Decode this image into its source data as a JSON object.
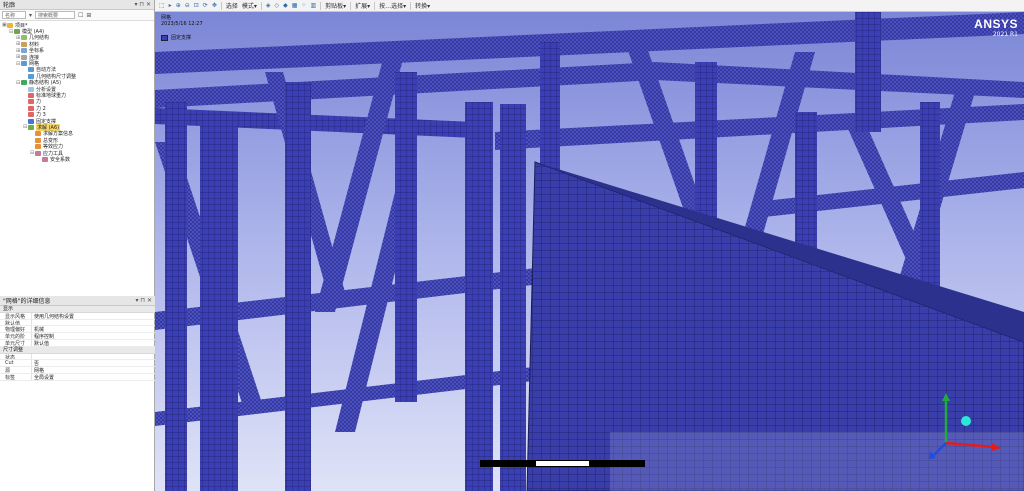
{
  "outline": {
    "title": "轮廓",
    "pin": "▾ ⊓ ✕",
    "filter_label": "名称",
    "search_placeholder": "搜索概要",
    "tree": [
      {
        "level": 0,
        "exp": "▣",
        "icon": "proj",
        "label": "项目*"
      },
      {
        "level": 1,
        "exp": "⊟",
        "icon": "model",
        "label": "模型 (A4)"
      },
      {
        "level": 2,
        "exp": "⊞",
        "icon": "geo",
        "label": "几何结构"
      },
      {
        "level": 2,
        "exp": "⊞",
        "icon": "mat",
        "label": "材料"
      },
      {
        "level": 2,
        "exp": "⊞",
        "icon": "coord",
        "label": "坐标系"
      },
      {
        "level": 2,
        "exp": "⊞",
        "icon": "conn",
        "label": "连接"
      },
      {
        "level": 2,
        "exp": "⊟",
        "icon": "mesh",
        "label": "网格"
      },
      {
        "level": 3,
        "exp": "",
        "icon": "mesh",
        "label": "自动方法"
      },
      {
        "level": 3,
        "exp": "",
        "icon": "mesh",
        "label": "几何结构尺寸调整"
      },
      {
        "level": 2,
        "exp": "⊟",
        "icon": "analysis",
        "label": "静态结构 (A5)"
      },
      {
        "level": 3,
        "exp": "",
        "icon": "env",
        "label": "分析设置"
      },
      {
        "level": 3,
        "exp": "",
        "icon": "load",
        "label": "标准地球重力"
      },
      {
        "level": 3,
        "exp": "",
        "icon": "load",
        "label": "力"
      },
      {
        "level": 3,
        "exp": "",
        "icon": "load",
        "label": "力 2"
      },
      {
        "level": 3,
        "exp": "",
        "icon": "load",
        "label": "力 3"
      },
      {
        "level": 3,
        "exp": "",
        "icon": "fixed",
        "label": "固定支撑"
      },
      {
        "level": 3,
        "exp": "⊟",
        "icon": "sol",
        "label": "求解 (A6)",
        "selected": true
      },
      {
        "level": 4,
        "exp": "",
        "icon": "res",
        "label": "求解方案信息"
      },
      {
        "level": 4,
        "exp": "",
        "icon": "res",
        "label": "总变形"
      },
      {
        "level": 4,
        "exp": "",
        "icon": "res",
        "label": "等效应力"
      },
      {
        "level": 4,
        "exp": "⊟",
        "icon": "safety",
        "label": "应力工具"
      },
      {
        "level": 5,
        "exp": "",
        "icon": "safety",
        "label": "安全系数"
      }
    ]
  },
  "details": {
    "title": "\"网格\"的详细信息",
    "pin": "▾ ⊓ ✕",
    "sections": [
      {
        "name": "显示",
        "rows": [
          {
            "k": "显示风格",
            "v": "使用几何结构设置"
          },
          {
            "k": "默认值",
            "v": ""
          },
          {
            "k": "物理偏好",
            "v": "机械"
          },
          {
            "k": "单元的阶",
            "v": "程序控制"
          },
          {
            "k": "单元尺寸",
            "v": "默认值"
          }
        ]
      },
      {
        "name": "尺寸调整",
        "rows": [
          {
            "k": "状态",
            "v": ""
          },
          {
            "k": "Cut",
            "v": "否"
          },
          {
            "k": "源",
            "v": "网格"
          },
          {
            "k": "标签",
            "v": "全局设置"
          }
        ]
      }
    ]
  },
  "toolbar": {
    "items": [
      {
        "name": "select-mode-icon",
        "text": "⬚",
        "icon": true
      },
      {
        "name": "select-arrow-icon",
        "text": "▸",
        "icon": true
      },
      {
        "name": "zoom-in-icon",
        "text": "⊕",
        "icon": true
      },
      {
        "name": "zoom-out-icon",
        "text": "⊖",
        "icon": true
      },
      {
        "name": "zoom-fit-icon",
        "text": "⊡",
        "icon": true
      },
      {
        "name": "rotate-icon",
        "text": "⟳",
        "icon": true
      },
      {
        "name": "pan-icon",
        "text": "✥",
        "icon": true
      },
      {
        "name": "sep",
        "text": ""
      },
      {
        "name": "select-button",
        "text": "选择"
      },
      {
        "name": "mode-button",
        "text": "模式▾"
      },
      {
        "name": "sep",
        "text": ""
      },
      {
        "name": "vertex-icon",
        "text": "◈",
        "icon": true
      },
      {
        "name": "edge-icon",
        "text": "◇",
        "icon": true
      },
      {
        "name": "face-icon",
        "text": "◆",
        "icon": true
      },
      {
        "name": "body-icon",
        "text": "▦",
        "icon": true
      },
      {
        "name": "node-icon",
        "text": "⁘",
        "icon": true
      },
      {
        "name": "element-icon",
        "text": "▥",
        "icon": true
      },
      {
        "name": "sep",
        "text": ""
      },
      {
        "name": "clipboard-button",
        "text": "剪贴板▾"
      },
      {
        "name": "sep",
        "text": ""
      },
      {
        "name": "extend-button",
        "text": "扩展▾"
      },
      {
        "name": "sep",
        "text": ""
      },
      {
        "name": "select-by-button",
        "text": "按…选择▾"
      },
      {
        "name": "sep",
        "text": ""
      },
      {
        "name": "convert-button",
        "text": "转换▾"
      }
    ]
  },
  "viewport": {
    "info_title": "网格",
    "info_date": "2023/5/16 12:27",
    "legend_label": "固定支撑",
    "brand_name": "ANSYS",
    "brand_version": "2021 R1"
  },
  "colors": {
    "mesh_fill": "#3b3fb5",
    "mesh_line": "#1c1f6e",
    "highlight": "#f5d76e",
    "axis_x": "#e11d1d",
    "axis_y": "#1faa3a",
    "axis_z": "#1d4ee1"
  }
}
